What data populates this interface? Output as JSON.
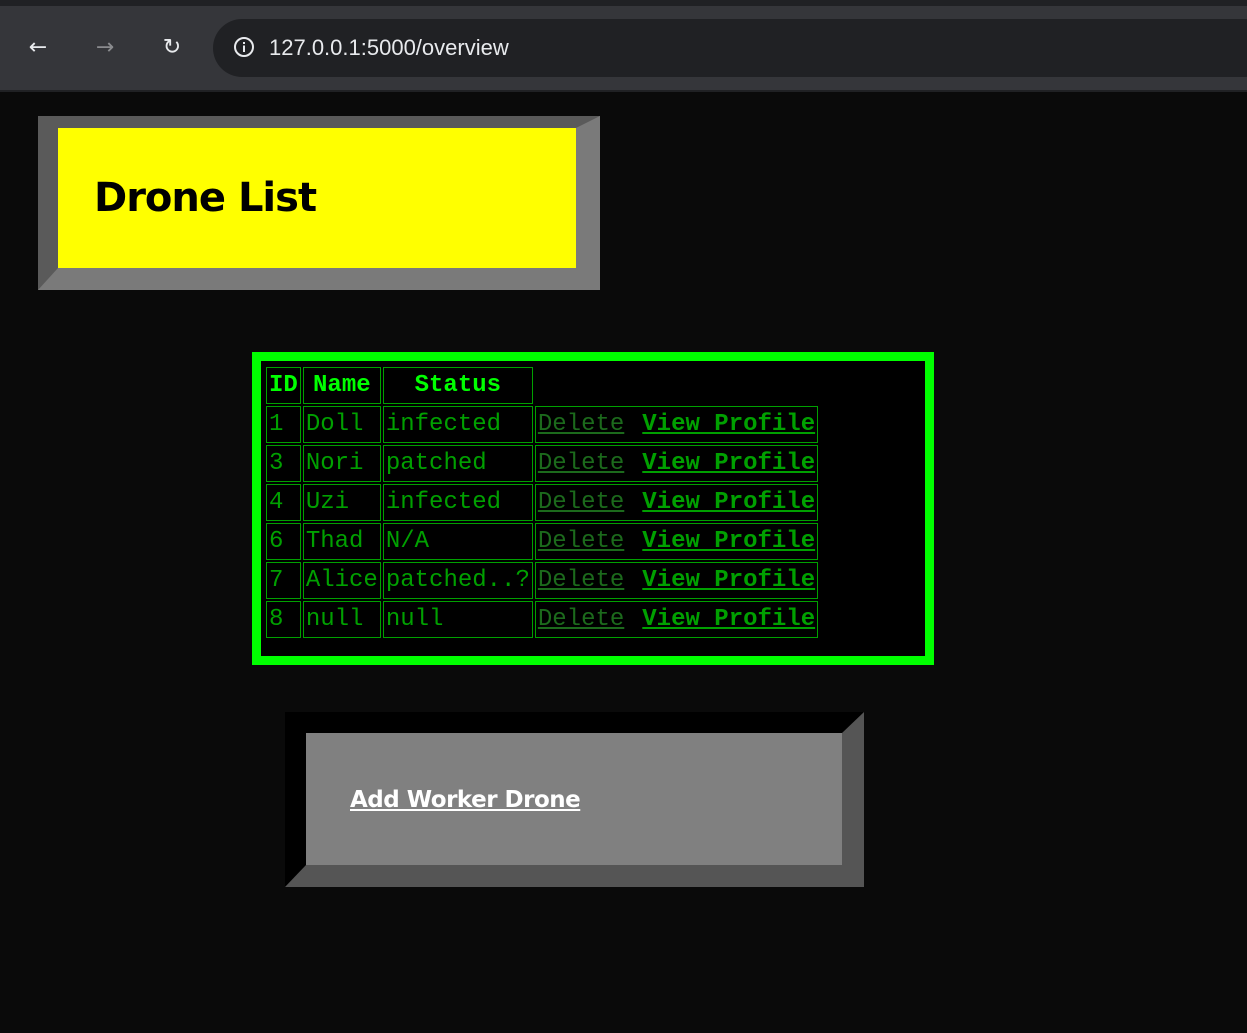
{
  "browser": {
    "back_icon": "←",
    "forward_icon": "→",
    "reload_icon": "↻",
    "url": "127.0.0.1:5000/overview"
  },
  "header": {
    "title": "Drone List"
  },
  "table": {
    "columns": [
      "ID",
      "Name",
      "Status",
      ""
    ],
    "rows": [
      {
        "id": "1",
        "name": "Doll",
        "status": "infected",
        "delete": "Delete",
        "profile": "View Profile"
      },
      {
        "id": "3",
        "name": "Nori",
        "status": "patched",
        "delete": "Delete",
        "profile": "View Profile"
      },
      {
        "id": "4",
        "name": "Uzi",
        "status": "infected",
        "delete": "Delete",
        "profile": "View Profile"
      },
      {
        "id": "6",
        "name": "Thad",
        "status": "N/A",
        "delete": "Delete",
        "profile": "View Profile"
      },
      {
        "id": "7",
        "name": "Alice",
        "status": "patched..?",
        "delete": "Delete",
        "profile": "View Profile"
      },
      {
        "id": "8",
        "name": "null",
        "status": "null",
        "delete": "Delete",
        "profile": "View Profile"
      }
    ]
  },
  "actions": {
    "add_label": "Add Worker Drone"
  },
  "colors": {
    "page_bg": "#0a0a0a",
    "title_bg": "#ffff00",
    "table_border": "#00ff00",
    "table_text": "#00a000",
    "add_box_bg": "#808080"
  }
}
